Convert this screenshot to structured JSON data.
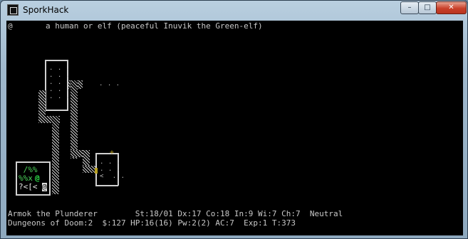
{
  "window": {
    "title": "SporkHack"
  },
  "controls": {
    "minimize": "–",
    "maximize": "□",
    "close": "✕"
  },
  "message": "@       a human or elf (peaceful Inuvik the Green-elf)",
  "status_line_1": "Armok the Plunderer        St:18/01 Dx:17 Co:18 In:9 Wi:7 Ch:7  Neutral",
  "status_line_2": "Dungeons of Doom:2  $:127 HP:16(16) Pw:2(2) AC:7  Exp:1 T:373",
  "map": {
    "room1_floor": ". . .\n. . .\n. . . .\n. . .\n. . .",
    "isolated_floor": ". . .",
    "room2_floor": ". . .\n. . .\n<  . .",
    "shop_row1": " /%%",
    "shop_row2": "%%x",
    "shop_pet": "@",
    "shop_row3": "?<[<",
    "player": "@",
    "door_glyph": "+"
  },
  "colors": {
    "terminal_bg": "#000000",
    "text": "#c8c8c8",
    "pet": "#2ee04a",
    "item_green": "#4bd25a",
    "door": "#b8a020"
  }
}
